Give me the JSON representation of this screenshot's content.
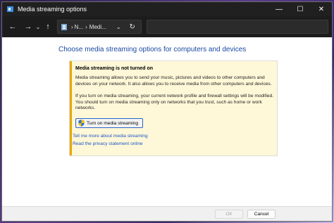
{
  "window": {
    "title": "Media streaming options",
    "minimize_glyph": "—",
    "maximize_glyph": "☐",
    "close_glyph": "✕"
  },
  "nav": {
    "back_glyph": "←",
    "forward_glyph": "→",
    "recent_glyph": "⌄",
    "up_glyph": "↑",
    "breadcrumb": [
      "N...",
      "Medi..."
    ],
    "breadcrumb_separator_glyph": "›",
    "breadcrumb_dropdown_glyph": "⌄",
    "refresh_glyph": "↻"
  },
  "main": {
    "heading": "Choose media streaming options for computers and devices",
    "infobox": {
      "title": "Media streaming is not turned on",
      "paragraph1": "Media streaming allows you to send your music, pictures and videos to other computers and devices on your network.  It also allows you to receive media from other computers and devices.",
      "paragraph2": "If you turn on media streaming, your current network profile and firewall settings will be modified. You should turn on media streaming only on networks that you trust, such as home or work networks.",
      "button_label": "Turn on media streaming"
    },
    "links": [
      "Tell me more about media streaming",
      "Read the privacy statement online"
    ]
  },
  "footer": {
    "ok_label": "OK",
    "cancel_label": "Cancel"
  },
  "colors": {
    "heading": "#1a4aa0",
    "link": "#1a55c8",
    "warning_stripe": "#e8a800",
    "infobox_bg": "#fff8d8"
  }
}
